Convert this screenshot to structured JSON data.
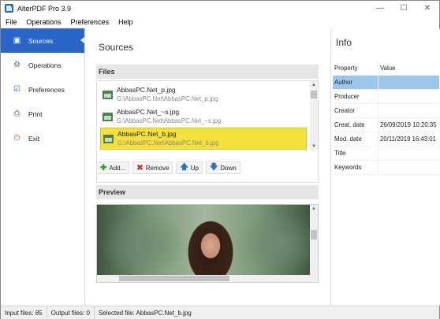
{
  "window": {
    "title": "AlterPDF Pro 3.9",
    "controls": [
      "—",
      "☐",
      "✕"
    ]
  },
  "menu": [
    "File",
    "Operations",
    "Preferences",
    "Help"
  ],
  "nav": {
    "items": [
      {
        "label": "Sources",
        "icon": "files-icon",
        "glyph": "▣",
        "active": true
      },
      {
        "label": "Operations",
        "icon": "gear-icon",
        "glyph": "⚙",
        "active": false
      },
      {
        "label": "Preferences",
        "icon": "checklist-icon",
        "glyph": "☑",
        "active": false
      },
      {
        "label": "Print",
        "icon": "printer-icon",
        "glyph": "⎙",
        "active": false
      },
      {
        "label": "Exit",
        "icon": "power-icon",
        "glyph": "⏻",
        "active": false
      }
    ]
  },
  "sources": {
    "title": "Sources",
    "files_header": "Files",
    "files": [
      {
        "name": "AbbasPC.Net_p.jpg",
        "path": "G:\\AbbasPC.Net\\AbbasPC.Net_p.jpg",
        "selected": false
      },
      {
        "name": "AbbasPC.Net_~s.jpg",
        "path": "G:\\AbbasPC.Net\\AbbasPC.Net_~s.jpg",
        "selected": false
      },
      {
        "name": "AbbasPC.Net_b.jpg",
        "path": "G:\\AbbasPC.Net\\AbbasPC.Net_b.jpg",
        "selected": true
      }
    ],
    "buttons": {
      "add": "Add...",
      "remove": "Remove",
      "up": "Up",
      "down": "Down"
    },
    "preview_header": "Preview"
  },
  "info": {
    "title": "Info",
    "col_property": "Property",
    "col_value": "Value",
    "rows": [
      {
        "k": "Author",
        "v": ""
      },
      {
        "k": "Producer",
        "v": ""
      },
      {
        "k": "Creator",
        "v": ""
      },
      {
        "k": "Creat. date",
        "v": "26/09/2019 10:20:35"
      },
      {
        "k": "Mod. date",
        "v": "20/11/2019 16:43:01"
      },
      {
        "k": "Title",
        "v": ""
      },
      {
        "k": "Keywords",
        "v": ""
      }
    ]
  },
  "status": {
    "input": "Input files: 85",
    "output": "Output files: 0",
    "selected": "Selected file: AbbasPC.Net_b.jpg"
  },
  "colors": {
    "nav_active": "#2a66c9",
    "selected_row": "#f5e13b",
    "info_highlight": "#9bc7ee",
    "add_icon": "#2e9b2e",
    "remove_icon": "#d2302a",
    "arrow_icon": "#2a6fc9",
    "exit_icon": "#e2582a"
  }
}
